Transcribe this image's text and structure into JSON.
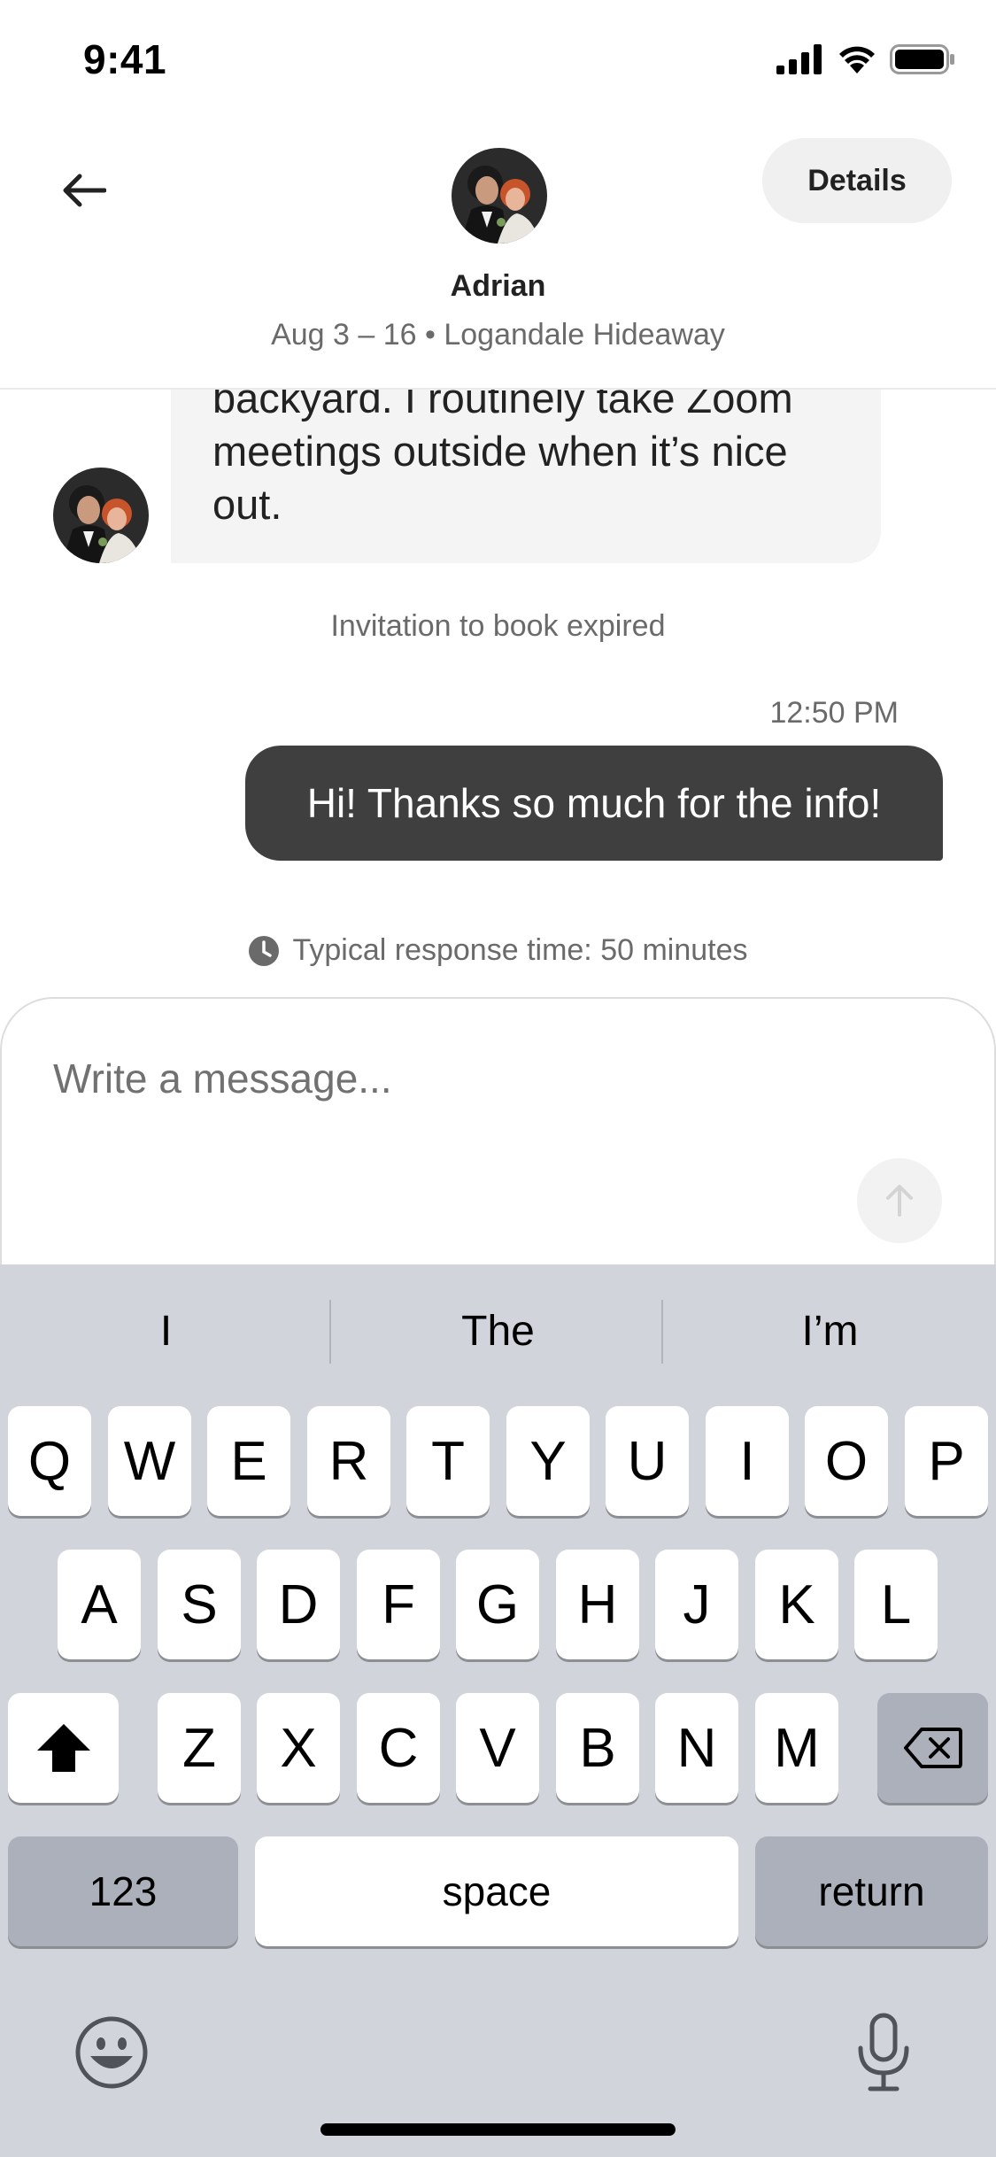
{
  "status_bar": {
    "time": "9:41"
  },
  "header": {
    "back_icon": "arrow-left-icon",
    "name": "Adrian",
    "subtitle": "Aug 3 – 16 • Logandale Hideaway",
    "details_label": "Details"
  },
  "messages": {
    "incoming": {
      "lines": [
        "backyard. I routinely take Zoom",
        "meetings outside when it’s nice",
        "out."
      ]
    },
    "system_notice": "Invitation to book expired",
    "outgoing": {
      "timestamp": "12:50 PM",
      "text": "Hi! Thanks so much for the info!"
    },
    "response_time": "Typical response time: 50 minutes"
  },
  "composer": {
    "placeholder": "Write a message...",
    "send_icon": "arrow-up-icon"
  },
  "keyboard": {
    "suggestions": [
      "I",
      "The",
      "I’m"
    ],
    "row1": [
      "Q",
      "W",
      "E",
      "R",
      "T",
      "Y",
      "U",
      "I",
      "O",
      "P"
    ],
    "row2": [
      "A",
      "S",
      "D",
      "F",
      "G",
      "H",
      "J",
      "K",
      "L"
    ],
    "row3": [
      "Z",
      "X",
      "C",
      "V",
      "B",
      "N",
      "M"
    ],
    "numbers_label": "123",
    "space_label": "space",
    "return_label": "return",
    "shift_icon": "shift-icon",
    "delete_icon": "delete-icon",
    "emoji_icon": "emoji-icon",
    "mic_icon": "microphone-icon"
  },
  "colors": {
    "outgoing_bubble": "#3f3f3f",
    "incoming_bubble": "#f4f4f4",
    "keyboard_bg": "#d1d4db"
  }
}
